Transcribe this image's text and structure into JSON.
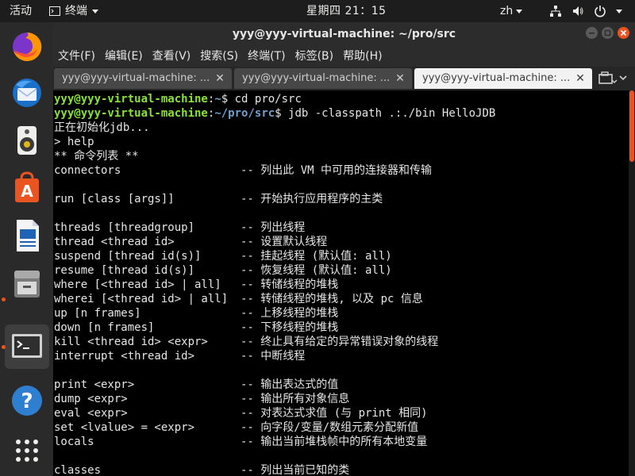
{
  "topbar": {
    "activities": "活动",
    "app_name": "终端",
    "clock": "星期四 21：15",
    "input_method": "zh"
  },
  "window": {
    "title": "yyy@yyy-virtual-machine: ~/pro/src"
  },
  "menu": [
    "文件(F)",
    "编辑(E)",
    "查看(V)",
    "搜索(S)",
    "终端(T)",
    "标签(B)",
    "帮助(H)"
  ],
  "tabs": [
    {
      "label": "yyy@yyy-virtual-machine: ..."
    },
    {
      "label": "yyy@yyy-virtual-machine: ..."
    },
    {
      "label": "yyy@yyy-virtual-machine: ..."
    }
  ],
  "terminal": {
    "prompt1": {
      "user": "yyy@yyy-virtual-machine",
      "sep": ":",
      "path": "~",
      "cmd": "$ cd pro/src"
    },
    "prompt2": {
      "user": "yyy@yyy-virtual-machine",
      "sep": ":",
      "path": "~/pro/src",
      "cmd": "$ jdb -classpath .:./bin HelloJDB"
    },
    "line_init": "正在初始化jdb...",
    "line_help": "> help",
    "line_header": "** 命令列表 **",
    "commands": [
      {
        "cmd": "connectors",
        "desc": "-- 列出此 VM 中可用的连接器和传输"
      },
      {
        "cmd": "run [class [args]]",
        "desc": "-- 开始执行应用程序的主类"
      },
      {
        "cmd": "threads [threadgroup]",
        "desc": "-- 列出线程"
      },
      {
        "cmd": "thread <thread id>",
        "desc": "-- 设置默认线程"
      },
      {
        "cmd": "suspend [thread id(s)]",
        "desc": "-- 挂起线程 (默认值: all)"
      },
      {
        "cmd": "resume [thread id(s)]",
        "desc": "-- 恢复线程 (默认值: all)"
      },
      {
        "cmd": "where [<thread id> | all]",
        "desc": "-- 转储线程的堆栈"
      },
      {
        "cmd": "wherei [<thread id> | all]",
        "desc": "-- 转储线程的堆栈, 以及 pc 信息"
      },
      {
        "cmd": "up [n frames]",
        "desc": "-- 上移线程的堆栈"
      },
      {
        "cmd": "down [n frames]",
        "desc": "-- 下移线程的堆栈"
      },
      {
        "cmd": "kill <thread id> <expr>",
        "desc": "-- 终止具有给定的异常错误对象的线程"
      },
      {
        "cmd": "interrupt <thread id>",
        "desc": "-- 中断线程"
      },
      {
        "cmd": "print <expr>",
        "desc": "-- 输出表达式的值"
      },
      {
        "cmd": "dump <expr>",
        "desc": "-- 输出所有对象信息"
      },
      {
        "cmd": "eval <expr>",
        "desc": "-- 对表达式求值 (与 print 相同)"
      },
      {
        "cmd": "set <lvalue> = <expr>",
        "desc": "-- 向字段/变量/数组元素分配新值"
      },
      {
        "cmd": "locals",
        "desc": "-- 输出当前堆栈帧中的所有本地变量"
      },
      {
        "cmd": "classes",
        "desc": "-- 列出当前已知的类"
      }
    ]
  },
  "dock": [
    "firefox-icon",
    "thunderbird-icon",
    "rhythmbox-icon",
    "software-center-icon",
    "libreoffice-writer-icon",
    "files-icon",
    "terminal-icon",
    "help-icon",
    "show-apps-icon"
  ],
  "colors": {
    "accent": "#e95420",
    "prompt_user": "#8ae234",
    "prompt_path": "#729fcf",
    "terminal_bg": "#000000"
  }
}
